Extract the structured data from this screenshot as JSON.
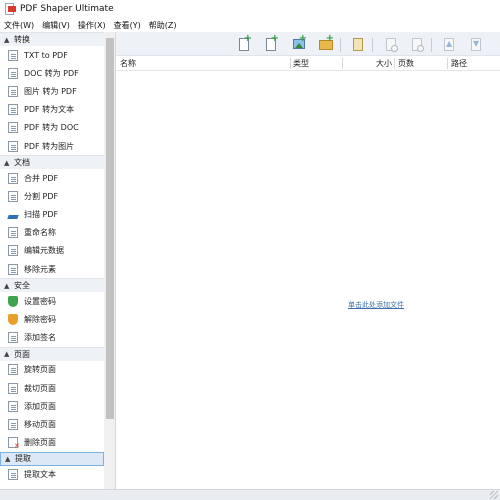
{
  "app": {
    "title": "PDF Shaper Ultimate",
    "icon": "pdf-shaper-app-icon"
  },
  "menu": [
    "文件(W)",
    "编辑(V)",
    "操作(X)",
    "查看(Y)",
    "帮助(Z)"
  ],
  "sidebar": {
    "groups": [
      {
        "title": "转换",
        "items": [
          {
            "label": "TXT to PDF",
            "icon": "txt-file-icon"
          },
          {
            "label": "DOC 转为 PDF",
            "icon": "doc-file-icon"
          },
          {
            "label": "图片 转为 PDF",
            "icon": "image-file-icon"
          },
          {
            "label": "PDF 转为文本",
            "icon": "pdf-text-icon"
          },
          {
            "label": "PDF 转为 DOC",
            "icon": "pdf-doc-icon"
          },
          {
            "label": "PDF 转为图片",
            "icon": "pdf-image-icon"
          }
        ]
      },
      {
        "title": "文档",
        "items": [
          {
            "label": "合并 PDF",
            "icon": "merge-icon"
          },
          {
            "label": "分割 PDF",
            "icon": "split-icon"
          },
          {
            "label": "扫描 PDF",
            "icon": "scan-icon"
          },
          {
            "label": "重命名称",
            "icon": "rename-icon"
          },
          {
            "label": "编辑元数据",
            "icon": "metadata-icon"
          },
          {
            "label": "移除元素",
            "icon": "remove-elements-icon"
          }
        ]
      },
      {
        "title": "安全",
        "items": [
          {
            "label": "设置密码",
            "icon": "shield-green-icon"
          },
          {
            "label": "解除密码",
            "icon": "shield-orange-icon"
          },
          {
            "label": "添加签名",
            "icon": "signature-icon"
          }
        ]
      },
      {
        "title": "页面",
        "items": [
          {
            "label": "旋转页面",
            "icon": "rotate-icon"
          },
          {
            "label": "裁切页面",
            "icon": "crop-icon"
          },
          {
            "label": "添加页面",
            "icon": "add-page-icon"
          },
          {
            "label": "移动页面",
            "icon": "move-page-icon"
          },
          {
            "label": "删除页面",
            "icon": "delete-page-icon"
          }
        ]
      },
      {
        "title": "提取",
        "items": [
          {
            "label": "提取文本",
            "icon": "extract-text-icon"
          }
        ]
      }
    ]
  },
  "toolbar": {
    "buttons": [
      "add-file-icon",
      "add-list-icon",
      "add-image-icon",
      "add-folder-icon",
      "clipboard-icon",
      "preview-icon",
      "properties-icon",
      "move-up-icon",
      "move-down-icon"
    ]
  },
  "table": {
    "columns": [
      "名称",
      "类型",
      "大小",
      "页数",
      "路径"
    ]
  },
  "empty_hint": "单击此处添加文件"
}
